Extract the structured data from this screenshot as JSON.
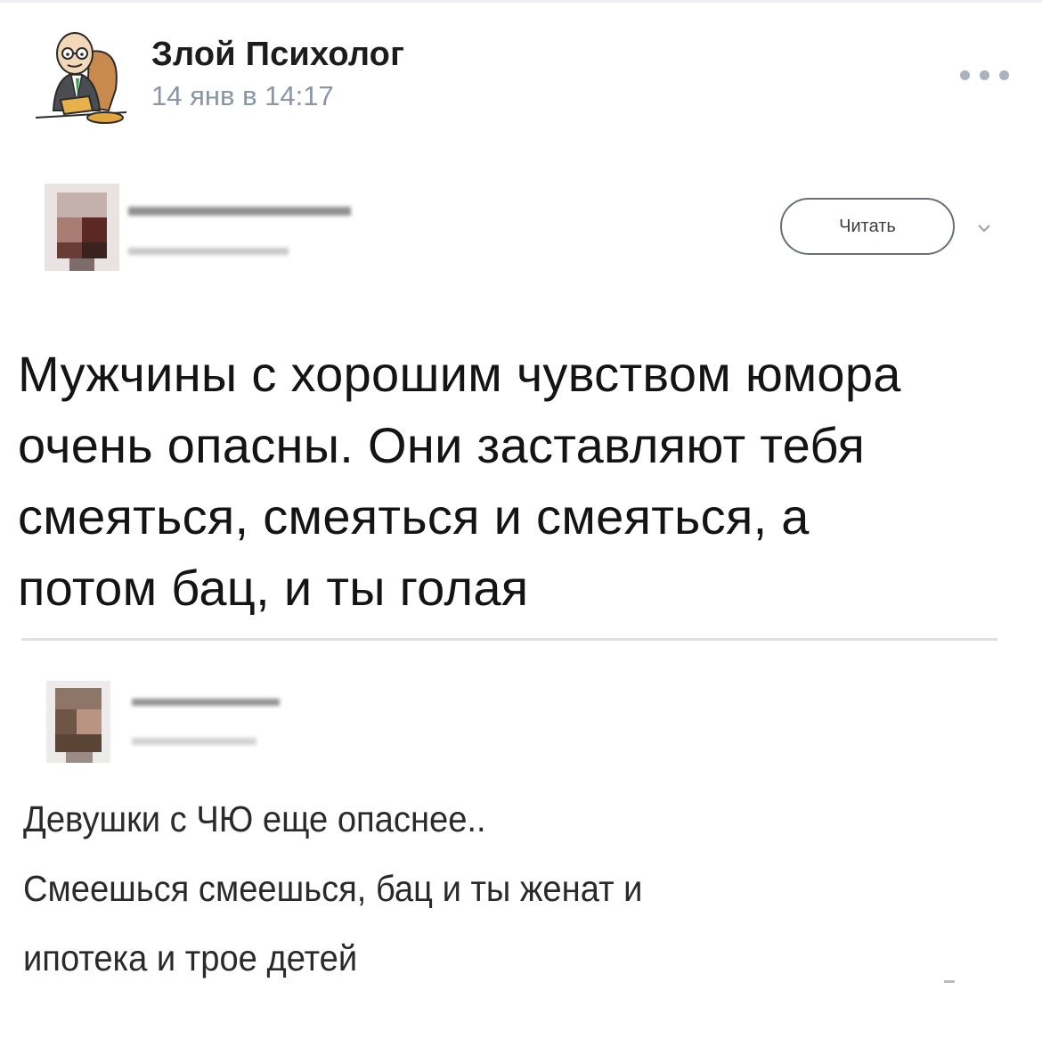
{
  "post": {
    "author": "Злой Психолог",
    "date": "14 янв в 14:17",
    "more_icon": "more-horizontal-icon"
  },
  "tweet": {
    "follow_label": "Читать",
    "lines": [
      "Мужчины с хорошим чувством юмора",
      "очень опасны. Они заставляют тебя",
      "смеяться, смеяться и смеяться, а",
      "потом бац, и ты голая"
    ]
  },
  "reply": {
    "lines": [
      "Девушки с ЧЮ еще опаснее..",
      "Смеешься смеешься, бац и ты женат и",
      "ипотека и трое детей"
    ]
  },
  "colors": {
    "author_text": "#1c1c1e",
    "date_text": "#8a96a6",
    "divider": "#dfe1e4"
  }
}
